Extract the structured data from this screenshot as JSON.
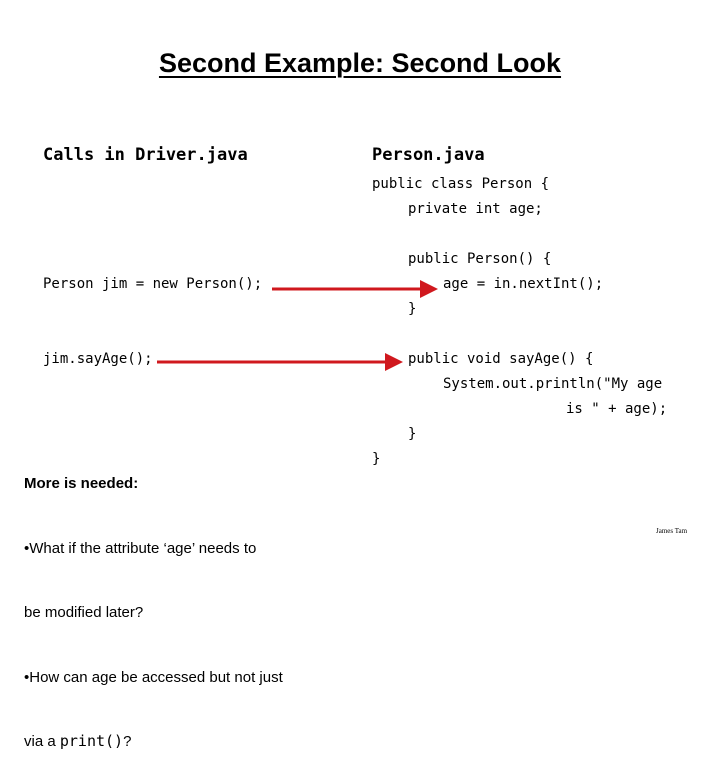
{
  "slide": {
    "title": "Second Example: Second Look",
    "left_header": "Calls in Driver.java",
    "right_header": "Person.java",
    "driver_calls": [
      "Person jim = new Person();",
      "jim.sayAge();"
    ],
    "person_code": [
      "public class Person {",
      "private int age;",
      "public Person() {",
      "age = in.nextInt();",
      "}",
      "public void sayAge() {",
      "System.out.println(\"My age",
      "is \" + age);",
      "}",
      "}"
    ],
    "note": {
      "heading": "More is needed:",
      "bullet1_line1": "•What if the attribute ‘age’ needs to",
      "bullet1_line2": "be modified later?",
      "bullet2_line1": "•How can age be accessed but not just",
      "bullet2_line2_prefix": "via a ",
      "bullet2_code": "print()",
      "bullet2_suffix": "?"
    },
    "footer": "James Tam",
    "arrow_color": "#d0181e"
  }
}
